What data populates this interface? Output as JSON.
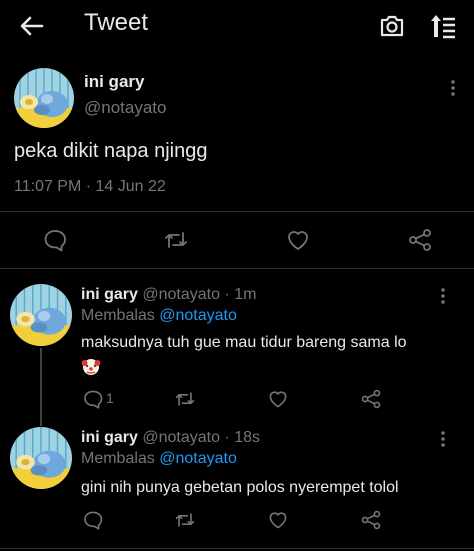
{
  "header": {
    "title": "Tweet",
    "icons": [
      "back-arrow-icon",
      "camera-icon",
      "sort-icon"
    ]
  },
  "colors": {
    "background": "#000000",
    "text": "#e7e9ea",
    "muted": "#71767b",
    "accent": "#1d9bf0",
    "divider": "#2f3336"
  },
  "main_tweet": {
    "name": "ini gary",
    "handle": "@notayato",
    "text": "peka dikit napa njingg",
    "meta": "11:07 PM · 14 Jun 22",
    "actions": [
      "reply-icon",
      "retweet-icon",
      "like-icon",
      "share-icon"
    ]
  },
  "replies": [
    {
      "name": "ini gary",
      "handle_time": " @notayato · 1m",
      "replying_prefix": "Membalas ",
      "replying_handle": "@notayato",
      "text": "maksudnya tuh gue mau tidur bareng sama lo",
      "emoji": "clown-face",
      "reply_count": "1"
    },
    {
      "name": "ini gary",
      "handle_time": " @notayato · 18s",
      "replying_prefix": "Membalas ",
      "replying_handle": "@notayato",
      "text": "gini nih punya gebetan polos nyerempet tolol",
      "reply_count": ""
    }
  ]
}
